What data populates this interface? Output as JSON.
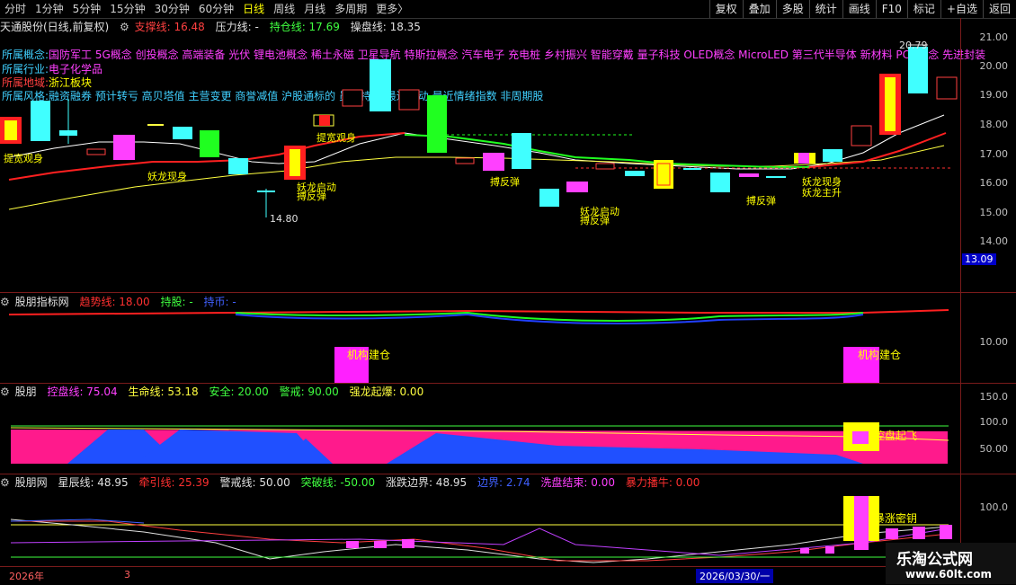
{
  "toolbar_left": [
    "分时",
    "1分钟",
    "5分钟",
    "15分钟",
    "30分钟",
    "60分钟",
    "日线",
    "周线",
    "月线",
    "多周期",
    "更多〉"
  ],
  "toolbar_right": [
    "复权",
    "叠加",
    "多股",
    "统计",
    "画线",
    "F10",
    "标记",
    "+自选",
    "返回"
  ],
  "main_header": {
    "stock": "天通股份(日线,前复权)",
    "support_label": "支撑线: 16.48",
    "pressure_label": "压力线: -",
    "hold_label": "持仓线: 17.69",
    "operate_label": "操盘线: 18.35"
  },
  "info": {
    "concept_label": "所属概念:",
    "concept_value": "国防军工 5G概念 创投概念 高端装备 光伏 锂电池概念 稀土永磁 卫星导航 特斯拉概念 汽车电子 充电桩 乡村振兴 智能穿戴 量子科技 OLED概念 MicroLED 第三代半导体 新材料 PCB概念 先进封装",
    "industry_label": "所属行业:",
    "industry_value": "电子化学品",
    "region_label": "所属地域:",
    "region_value": "浙江板块",
    "style_label": "所属风格:",
    "style_value": "融资融券 预计转亏 高贝塔值 主营变更 商誉减值 沪股通标的 员工持股 最近异动 最近情绪指数 非周期股"
  },
  "main_axis": [
    "21.00",
    "20.00",
    "19.00",
    "18.00",
    "17.00",
    "16.00",
    "15.00",
    "14.00"
  ],
  "price_box": "13.09",
  "high_label": "20.79",
  "low_label": "14.80",
  "main_annotations": [
    {
      "t": "提宽观身",
      "c": "#ffff00"
    },
    {
      "t": "提宽观身",
      "c": "#ffff00"
    },
    {
      "t": "妖龙现身",
      "c": "#ffff00"
    },
    {
      "t": "妖龙启动",
      "c": "#ffff00"
    },
    {
      "t": "搏反弹",
      "c": "#ffff00"
    },
    {
      "t": "搏反弹",
      "c": "#ffff00"
    },
    {
      "t": "妖龙启动",
      "c": "#ffff00"
    },
    {
      "t": "搏反弹",
      "c": "#ffff00"
    },
    {
      "t": "搏反弹",
      "c": "#ffff00"
    },
    {
      "t": "妖龙现身",
      "c": "#ffff00"
    },
    {
      "t": "妖龙主升",
      "c": "#ffff00"
    }
  ],
  "panel2": {
    "name": "股朋指标网",
    "trend": "趋势线: 18.00",
    "hold": "持股: -",
    "coin": "持币: -",
    "axis": "10.00",
    "tag1": "机构建仓",
    "tag2": "机构建仓"
  },
  "panel3": {
    "name": "股朋",
    "control": "控盘线: 75.04",
    "life": "生命线: 53.18",
    "safe": "安全: 20.00",
    "warn": "警戒: 90.00",
    "dragon": "强龙起爆: 0.00",
    "axis": [
      "150.0",
      "100.0",
      "50.00"
    ],
    "tag": "控盘起飞"
  },
  "panel4": {
    "name": "股朋网",
    "star": "星辰线: 48.95",
    "pull": "牵引线: 25.39",
    "alert": "警戒线: 50.00",
    "break": "突破线: -50.00",
    "border": "涨跌边界: 48.95",
    "edge": "边界: 2.74",
    "wash": "洗盘结束: 0.00",
    "bull": "暴力播牛: 0.00",
    "axis": "100.0",
    "tag": "暴涨密钥"
  },
  "datebar": {
    "year": "2026年",
    "month": "3",
    "date": "2026/03/30/一"
  },
  "logo": {
    "name": "乐淘公式网",
    "url": "www.60lt.com"
  },
  "colors": {
    "up": "#ff3030",
    "down": "#40ffff",
    "axis_border": "#7a1b1b",
    "highlight": "#ffff00"
  }
}
